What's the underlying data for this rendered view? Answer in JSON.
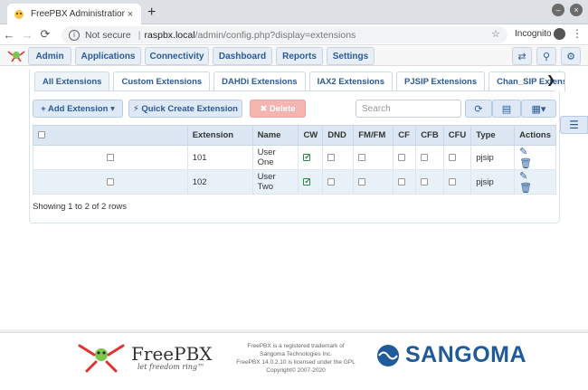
{
  "browser": {
    "tab_title": "FreePBX Administration",
    "tab_close": "×",
    "new_tab": "+",
    "url_secure_label": "Not secure",
    "url_host": "raspbx.local",
    "url_path": "/admin/config.php?display=extensions",
    "incognito_label": "Incognito"
  },
  "nav": {
    "items": [
      "Admin",
      "Applications",
      "Connectivity",
      "Dashboard",
      "Reports",
      "Settings"
    ]
  },
  "tabs": [
    "All Extensions",
    "Custom Extensions",
    "DAHDi Extensions",
    "IAX2 Extensions",
    "PJSIP Extensions",
    "Chan_SIP Extensi"
  ],
  "toolbar": {
    "add_extension": "+ Add Extension ▾",
    "quick_create": "⚡ Quick Create Extension",
    "delete": "✖ Delete",
    "search_placeholder": "Search"
  },
  "table": {
    "headers": [
      "",
      "Extension",
      "Name",
      "CW",
      "DND",
      "FM/FM",
      "CF",
      "CFB",
      "CFU",
      "Type",
      "Actions"
    ],
    "rows": [
      {
        "extension": "101",
        "name": "User One",
        "cw": true,
        "dnd": false,
        "fmfm": false,
        "cf": false,
        "cfb": false,
        "cfu": false,
        "type": "pjsip"
      },
      {
        "extension": "102",
        "name": "User Two",
        "cw": true,
        "dnd": false,
        "fmfm": false,
        "cf": false,
        "cfb": false,
        "cfu": false,
        "type": "pjsip"
      }
    ],
    "showing": "Showing 1 to 2 of 2 rows"
  },
  "footer": {
    "brand_name": "FreePBX",
    "brand_tag": "let freedom ring™",
    "legal_1": "FreePBX is a registered trademark of",
    "legal_2": "Sangoma Technologies Inc.",
    "legal_3": "FreePBX 14.0.2.10 is licensed under the GPL",
    "legal_4": "Copyright© 2007-2020",
    "sangoma": "SANGOMA"
  },
  "colors": {
    "accent": "#2a5a9a",
    "delete": "#f4b4b0",
    "header_bg": "#dce7f3"
  }
}
